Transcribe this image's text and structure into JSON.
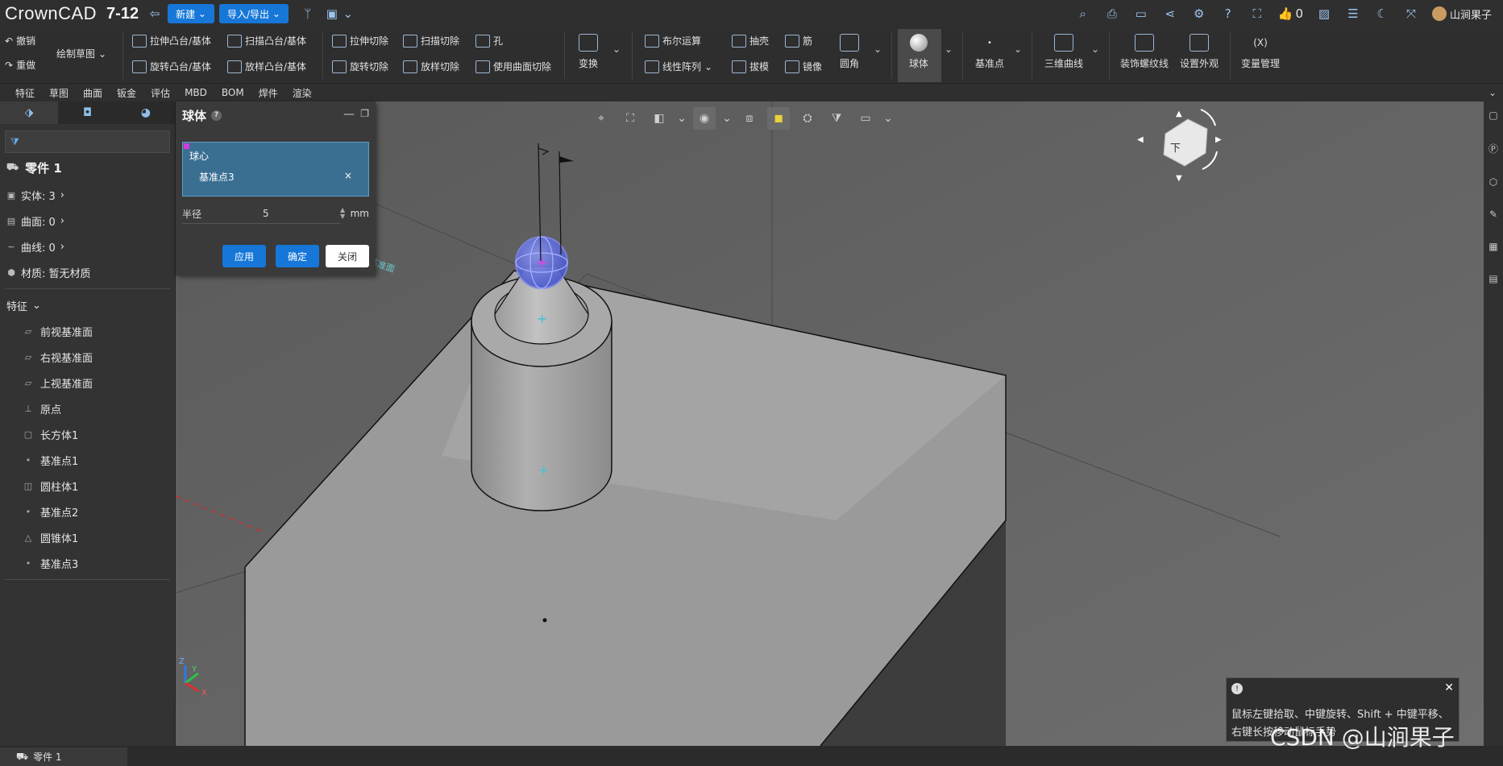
{
  "app": {
    "logo": "CrownCAD",
    "version": "7-12"
  },
  "topbar": {
    "new_label": "新建",
    "import_export_label": "导入/导出",
    "likes": "0",
    "user": "山涧果子"
  },
  "ribbon": {
    "undo": "撤销",
    "redo": "重做",
    "sketch": "绘制草图",
    "extrude_boss": "拉伸凸台/基体",
    "sweep_boss": "扫描凸台/基体",
    "revolve_boss": "旋转凸台/基体",
    "loft_boss": "放样凸台/基体",
    "extrude_cut": "拉伸切除",
    "sweep_cut": "扫描切除",
    "hole": "孔",
    "revolve_cut": "旋转切除",
    "loft_cut": "放样切除",
    "surface_cut": "使用曲面切除",
    "transform": "变换",
    "boolean": "布尔运算",
    "linear_pattern": "线性阵列",
    "shell": "抽壳",
    "rib": "筋",
    "draft": "拔模",
    "mirror": "镜像",
    "fillet": "圆角",
    "sphere": "球体",
    "ref_point": "基准点",
    "curve3d": "三维曲线",
    "thread": "装饰螺纹线",
    "appearance": "设置外观",
    "variables": "变量管理",
    "variables_icon": "(X)"
  },
  "tabs": [
    "特征",
    "草图",
    "曲面",
    "钣金",
    "评估",
    "MBD",
    "BOM",
    "焊件",
    "渲染"
  ],
  "tree": {
    "part": "零件 1",
    "solids": "实体: 3",
    "surfaces": "曲面: 0",
    "curves": "曲线: 0",
    "material": "材质: 暂无材质",
    "features_header": "特征",
    "items": [
      "前视基准面",
      "右视基准面",
      "上视基准面",
      "原点",
      "长方体1",
      "基准点1",
      "圆柱体1",
      "基准点2",
      "圆锥体1",
      "基准点3"
    ]
  },
  "dialog": {
    "title": "球体",
    "center_label": "球心",
    "center_value": "基准点3",
    "radius_label": "半径",
    "radius_value": "5",
    "unit": "mm",
    "apply": "应用",
    "ok": "确定",
    "close": "关闭"
  },
  "viewport": {
    "plane_label": "前视基准面",
    "axis_x": "X",
    "axis_y": "Y",
    "axis_z": "Z",
    "cube_face": "下"
  },
  "tip": {
    "line1": "鼠标左键拾取、中键旋转、Shift + 中键平移、",
    "line2": "右键长按移动鼠标手势"
  },
  "statusbar": {
    "tab": "零件 1"
  },
  "watermark": "CSDN @山涧果子",
  "colors": {
    "accent": "#1677d8",
    "selection": "#3a6f92",
    "sphere": "#5a6bd8"
  }
}
